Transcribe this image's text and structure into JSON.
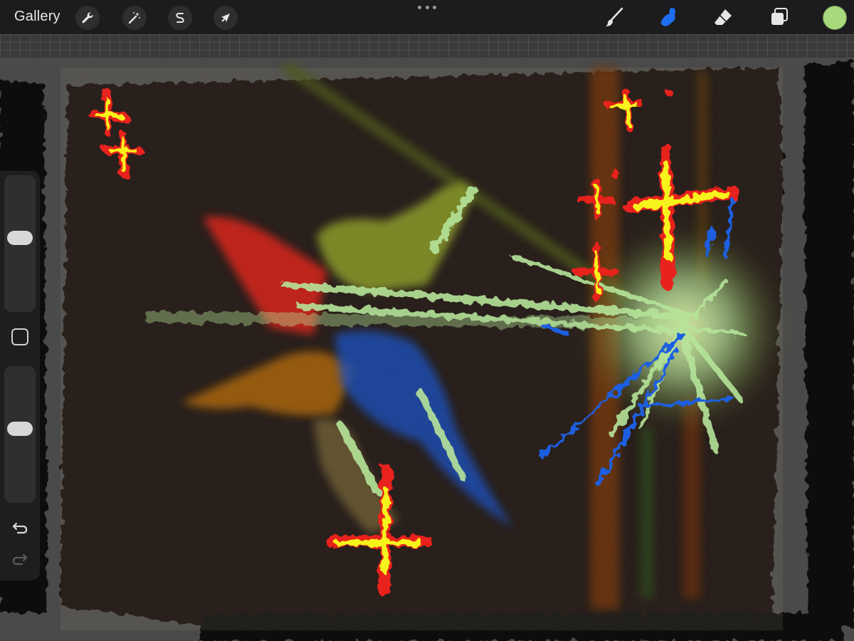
{
  "toolbar": {
    "gallery_label": "Gallery",
    "left_tools": [
      {
        "name": "actions",
        "icon": "wrench-icon"
      },
      {
        "name": "adjustments",
        "icon": "magic-wand-icon"
      },
      {
        "name": "selection",
        "icon": "selection-s-icon"
      },
      {
        "name": "transform",
        "icon": "arrow-cursor-icon"
      }
    ],
    "right_tools": [
      {
        "name": "brush",
        "icon": "paintbrush-icon",
        "active": false
      },
      {
        "name": "smudge",
        "icon": "smudge-finger-icon",
        "active": true
      },
      {
        "name": "eraser",
        "icon": "eraser-icon",
        "active": false
      },
      {
        "name": "layers",
        "icon": "layers-icon",
        "active": false
      }
    ],
    "active_tool_color": "#1e6ef0",
    "current_color": "#a8d97c"
  },
  "sidebar": {
    "brush_size_level": 0.55,
    "opacity_level": 0.55,
    "modify_icon": "square-modify-icon",
    "undo_icon": "undo-arrow-icon",
    "redo_icon": "redo-arrow-icon"
  },
  "canvas": {
    "background": "#4a4a4a",
    "artwork_colors": {
      "dark_base": "#120f0c",
      "red": "#d8251c",
      "yellow": "#f7f31a",
      "pale_green": "#b6e59a",
      "olive": "#8a9a2b",
      "orange_brown": "#a8650f",
      "blue": "#1f4fb8",
      "vertical_streak": "#7a3a0e"
    }
  }
}
